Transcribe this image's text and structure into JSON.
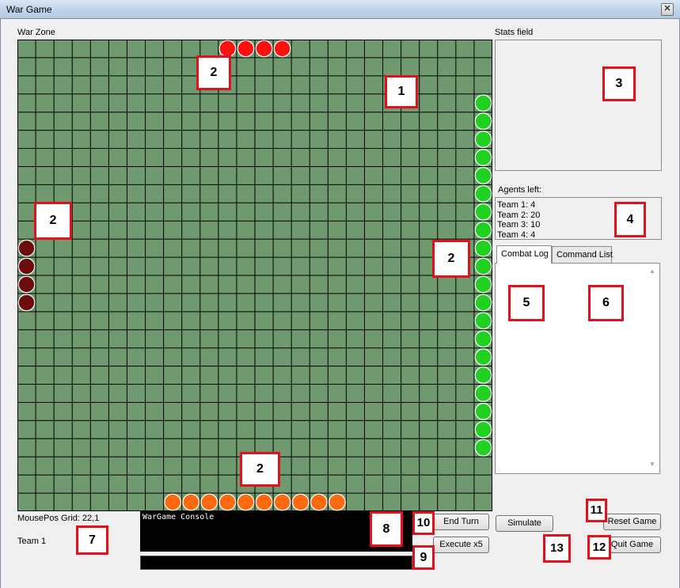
{
  "window": {
    "title": "War Game",
    "close_glyph": "✕"
  },
  "labels": {
    "war_zone": "War Zone",
    "stats_field": "Stats field",
    "agents_left": "Agents left:",
    "mouse_pos": "MousePos Grid: 22,1",
    "team": "Team 1"
  },
  "agents": [
    "Team 1: 4",
    "Team 2: 20",
    "Team 3: 10",
    "Team 4: 4"
  ],
  "tabs": [
    {
      "label": "Combat Log",
      "active": true
    },
    {
      "label": "Command List",
      "active": false
    }
  ],
  "console": {
    "text": "WarGame Console"
  },
  "buttons": {
    "end_turn": "End Turn",
    "execute_x5": "Execute x5",
    "simulate": "Simulate",
    "reset_game": "Reset Game",
    "quit_game": "Quit Game"
  },
  "markers": [
    "1",
    "2",
    "2",
    "2",
    "2",
    "3",
    "4",
    "5",
    "6",
    "7",
    "8",
    "9",
    "10",
    "11",
    "12",
    "13"
  ],
  "grid": {
    "cols": 26,
    "rows": 26,
    "background": "#6f9a70",
    "line_color": "#000000",
    "units": [
      {
        "team": "red",
        "color": "#ff1010",
        "cells": [
          [
            11,
            0
          ],
          [
            12,
            0
          ],
          [
            13,
            0
          ],
          [
            14,
            0
          ]
        ]
      },
      {
        "team": "green",
        "color": "#22d022",
        "cells": [
          [
            25,
            3
          ],
          [
            25,
            4
          ],
          [
            25,
            5
          ],
          [
            25,
            6
          ],
          [
            25,
            7
          ],
          [
            25,
            8
          ],
          [
            25,
            9
          ],
          [
            25,
            10
          ],
          [
            25,
            11
          ],
          [
            25,
            12
          ],
          [
            25,
            13
          ],
          [
            25,
            14
          ],
          [
            25,
            15
          ],
          [
            25,
            16
          ],
          [
            25,
            17
          ],
          [
            25,
            18
          ],
          [
            25,
            19
          ],
          [
            25,
            20
          ],
          [
            25,
            21
          ],
          [
            25,
            22
          ]
        ]
      },
      {
        "team": "maroon",
        "color": "#6b0d0d",
        "cells": [
          [
            0,
            11
          ],
          [
            0,
            12
          ],
          [
            0,
            13
          ],
          [
            0,
            14
          ]
        ]
      },
      {
        "team": "orange",
        "color": "#ff6a10",
        "cells": [
          [
            8,
            25
          ],
          [
            9,
            25
          ],
          [
            10,
            25
          ],
          [
            11,
            25
          ],
          [
            12,
            25
          ],
          [
            13,
            25
          ],
          [
            14,
            25
          ],
          [
            15,
            25
          ],
          [
            16,
            25
          ],
          [
            17,
            25
          ]
        ]
      }
    ]
  },
  "colors": {
    "marker_border": "#e0121e",
    "console_bg": "#000000"
  }
}
